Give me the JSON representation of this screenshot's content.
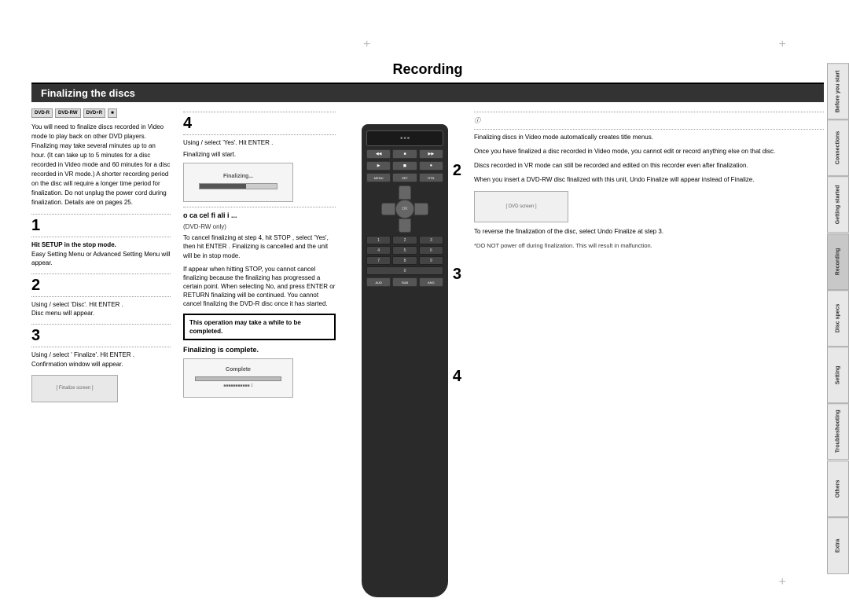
{
  "page": {
    "title": "Recording",
    "section": "Finalizing the discs"
  },
  "tabs": [
    {
      "label": "Before you start",
      "active": false
    },
    {
      "label": "Connections",
      "active": false
    },
    {
      "label": "Getting started",
      "active": false
    },
    {
      "label": "Recording",
      "active": true
    },
    {
      "label": "Disc specs",
      "active": false
    },
    {
      "label": "Setting",
      "active": false
    },
    {
      "label": "Troubleshooting",
      "active": false
    },
    {
      "label": "Others",
      "active": false
    },
    {
      "label": "Extra",
      "active": false
    }
  ],
  "left_col": {
    "intro_text": "You will need to finalize discs recorded in Video mode to play back on other DVD players. Finalizing may take several minutes up to an hour. (It can take up to 5 minutes for a disc recorded in Video mode and 60 minutes for a disc recorded in VR mode.) A shorter recording period on the disc will require a longer time period for finalization. Do not unplug the power cord during finalization. Details are on pages 25.",
    "step1_label": "Hit  SETUP  in the stop mode.",
    "step1_text": "Easy Setting Menu or Advanced Setting Menu will appear.",
    "step2_label": "Using  /   select 'Disc'. Hit  ENTER .",
    "step2_text": "Disc menu will appear.",
    "step3_label": "Using  /   select ' Finalize'. Hit  ENTER .",
    "step3_text": "Confirmation window will appear."
  },
  "middle_col": {
    "step4_label": "Using  /   select 'Yes'. Hit  ENTER .",
    "step4_text": "Finalizing will start.",
    "cancel_text": "o ca cel fi ali  i  ...",
    "cancel_subtext": "(DVD-RW only)",
    "cancel_detail": "To cancel finalizing at step 4, hit  STOP ,  select 'Yes', then hit  ENTER . Finalizing is cancelled and the unit will be in stop mode.",
    "stop_note": "If  appear when hitting STOP,  you cannot cancel finalizing because the finalizing has progressed a certain point. When selecting No, and press ENTER  or RETURN   finalizing will be continued. You cannot cancel finalizing the DVD-R disc once it has started.",
    "highlight_text": "This operation may take a while to be completed.",
    "finalize_complete": "Finalizing is complete."
  },
  "right_col": {
    "text1": "Finalizing discs in Video mode automatically creates title menus.",
    "text2": "Once you have finalized a disc recorded in Video mode, you cannot edit or record anything else on that disc.",
    "text3": "Discs recorded in VR mode can still be recorded and edited on this recorder even after finalization.",
    "text4": "When you insert a DVD-RW disc finalized with this unit, Undo Finalize will appear instead of  Finalize.",
    "reverse_text": "To reverse the finalization of the disc, select Undo Finalize at step 3.",
    "warning": "*DO NOT power off during finalization. This will result in malfunction."
  },
  "steps": {
    "step2_marker": "2",
    "step3_marker": "3",
    "step4_marker": "4"
  }
}
